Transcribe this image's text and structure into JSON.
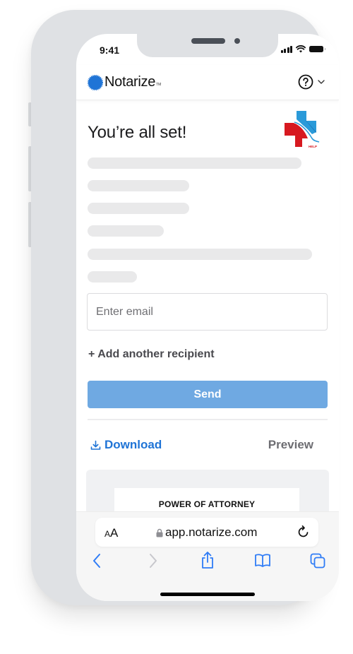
{
  "status_bar": {
    "time": "9:41",
    "icons": [
      "cellular-signal-icon",
      "wifi-icon",
      "battery-icon"
    ]
  },
  "header": {
    "logo_text": "Notarize",
    "logo_tm": "TM",
    "help_icon": "question-circle-icon",
    "dropdown_icon": "chevron-down-icon"
  },
  "main": {
    "heading": "You’re all set!",
    "brand_mark": "medical-cross-help-logo",
    "brand_mark_text": "HELP",
    "skeleton_lines": 6,
    "email_input": {
      "value": "",
      "placeholder": "Enter email"
    },
    "add_recipient_label": "+ Add another recipient",
    "send_label": "Send",
    "download_label": "Download",
    "preview_label": "Preview",
    "document_title": "POWER OF ATTORNEY"
  },
  "browser": {
    "text_size_label_small": "A",
    "text_size_label_large": "A",
    "url": "app.notarize.com",
    "secure_icon": "lock-icon",
    "reload_icon": "reload-icon",
    "toolbar": [
      "back-icon",
      "forward-icon",
      "share-icon",
      "bookmarks-icon",
      "tabs-icon"
    ]
  },
  "colors": {
    "brand_blue": "#1f74d6",
    "send_button": "#6fa9e2",
    "frame": "#dfe1e4",
    "skeleton": "#e9e9ea",
    "ios_blue": "#2f7cf6"
  }
}
